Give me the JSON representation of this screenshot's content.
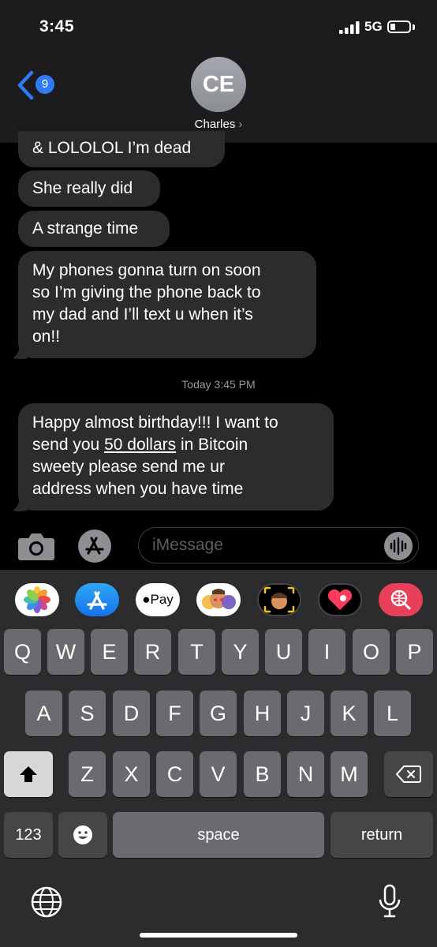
{
  "status_bar": {
    "time": "3:45",
    "network": "5G"
  },
  "header": {
    "unread_count": "9",
    "avatar_initials": "CE",
    "contact_name": "Charles",
    "chevron": "›"
  },
  "messages": [
    {
      "text": "& LOLOLOL I’m dead"
    },
    {
      "text": "She really did"
    },
    {
      "text": "A strange time"
    },
    {
      "lines": [
        "My phones gonna turn on soon",
        "so I’m giving the phone back to",
        "my dad and I’ll text u when it’s",
        "on!!"
      ]
    }
  ],
  "timestamp": {
    "day": "Today",
    "time": "3:45 PM"
  },
  "last_message": {
    "line1": "Happy almost birthday!!! I want to",
    "line2_prefix": "send you ",
    "line2_link": "50 dollars",
    "line2_suffix": " in Bitcoin",
    "line3": "sweety please send me ur",
    "line4": "address when you have time"
  },
  "input": {
    "placeholder": "iMessage"
  },
  "app_drawer": {
    "icons": [
      "photos-icon",
      "app-store-icon",
      "apple-pay-icon",
      "memoji-stickers-icon",
      "memoji-camera-icon",
      "digital-touch-icon",
      "web-images-icon"
    ],
    "apple_pay_label": "Pay"
  },
  "keyboard": {
    "row1": [
      "Q",
      "W",
      "E",
      "R",
      "T",
      "Y",
      "U",
      "I",
      "O",
      "P"
    ],
    "row2": [
      "A",
      "S",
      "D",
      "F",
      "G",
      "H",
      "J",
      "K",
      "L"
    ],
    "row3": [
      "Z",
      "X",
      "C",
      "V",
      "B",
      "N",
      "M"
    ],
    "numbers_label": "123",
    "space_label": "space",
    "return_label": "return"
  }
}
